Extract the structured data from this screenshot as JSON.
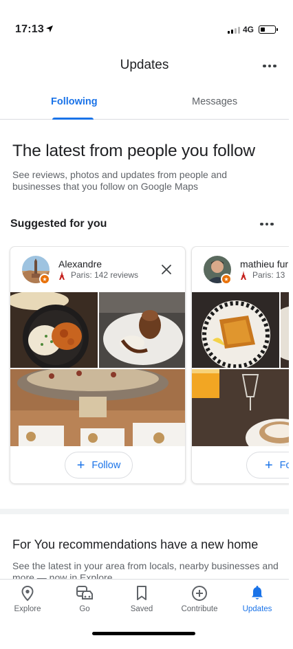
{
  "status_bar": {
    "time": "17:13",
    "network": "4G"
  },
  "header": {
    "title": "Updates",
    "more_icon": "more-horizontal-icon"
  },
  "tabs": [
    {
      "label": "Following",
      "active": true
    },
    {
      "label": "Messages",
      "active": false
    }
  ],
  "intro": {
    "title": "The latest from people you follow",
    "subtitle": "See reviews, photos and updates from people and businesses that you follow on Google Maps"
  },
  "suggested": {
    "title": "Suggested for you",
    "cards": [
      {
        "name": "Alexandre",
        "meta": "Paris: 142 reviews",
        "follow_label": "Follow"
      },
      {
        "name": "mathieu fur",
        "meta": "Paris: 13",
        "follow_label": "Foll"
      }
    ]
  },
  "for_you": {
    "title": "For You recommendations have a new home",
    "subtitle": "See the latest in your area from locals, nearby businesses and more — now in Explore"
  },
  "bottom_nav": [
    {
      "label": "Explore",
      "icon": "location-pin-icon",
      "active": false
    },
    {
      "label": "Go",
      "icon": "commute-icon",
      "active": false
    },
    {
      "label": "Saved",
      "icon": "bookmark-icon",
      "active": false
    },
    {
      "label": "Contribute",
      "icon": "add-circle-icon",
      "active": false
    },
    {
      "label": "Updates",
      "icon": "bell-icon",
      "active": true
    }
  ],
  "colors": {
    "accent": "#1a73e8",
    "text": "#202124",
    "secondary": "#5f6368",
    "badge": "#e8710a"
  }
}
